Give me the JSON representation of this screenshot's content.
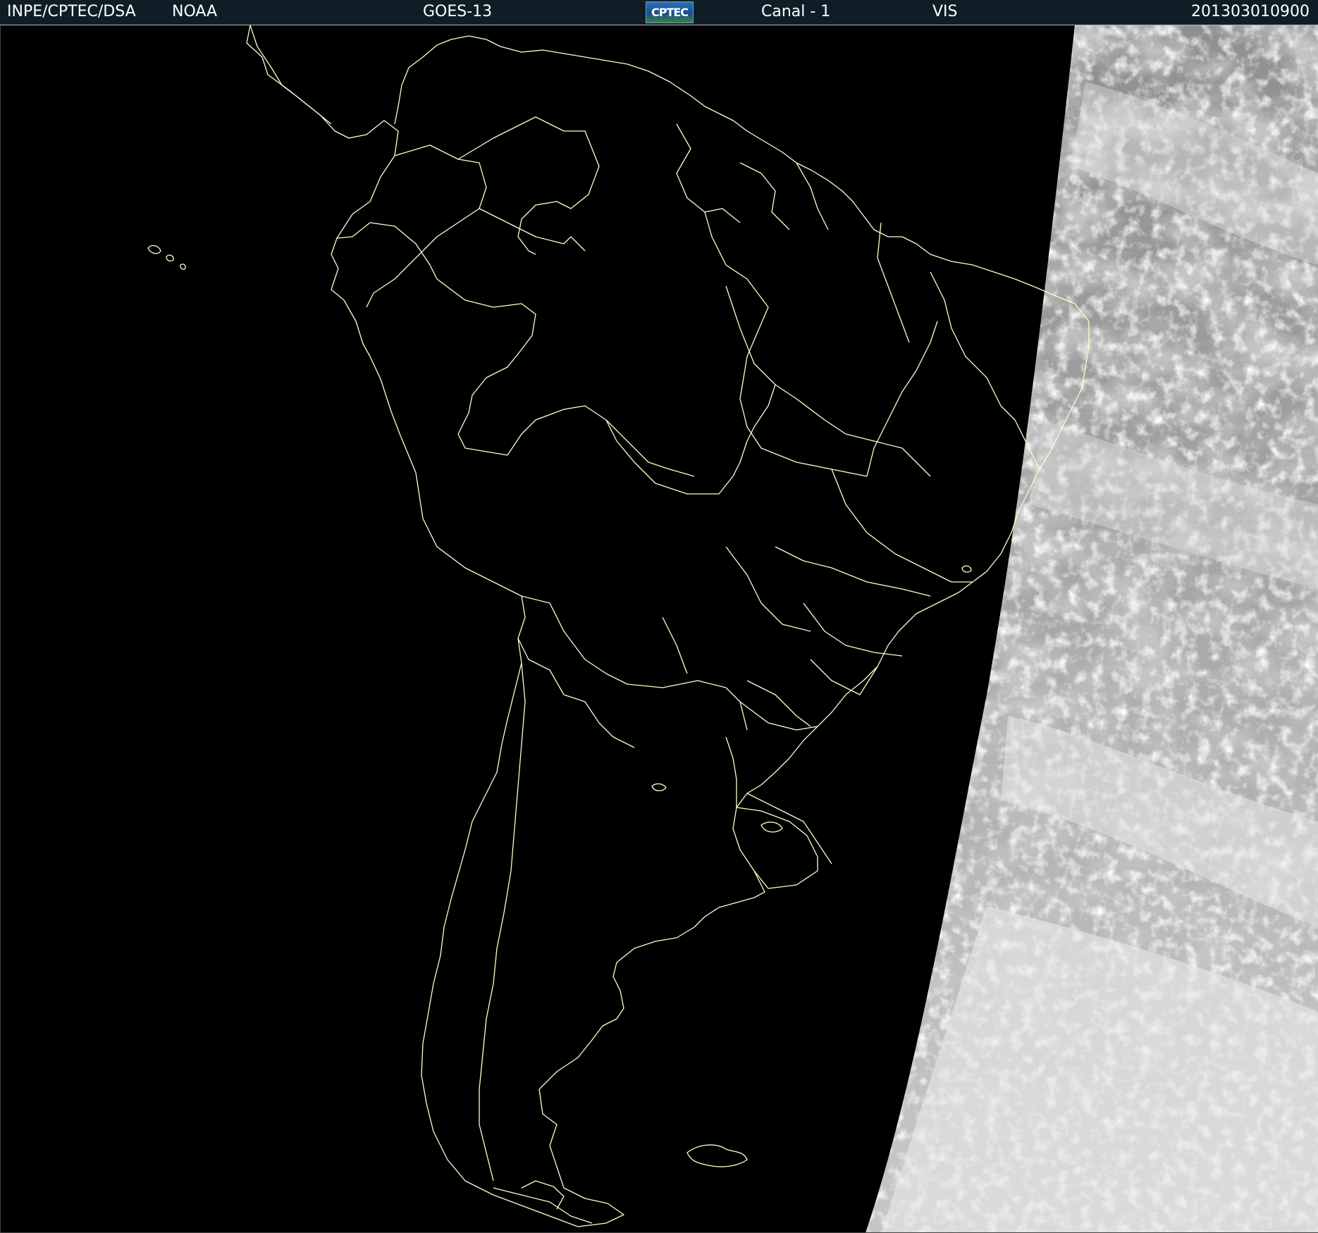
{
  "header": {
    "institution": "INPE/CPTEC/DSA",
    "agency": "NOAA",
    "satellite": "GOES-13",
    "logo_text": "CPTEC",
    "channel": "Canal - 1",
    "band": "VIS",
    "timestamp": "201303010900"
  },
  "map": {
    "region": "South America",
    "background_color": "#000000",
    "border_color": "#ffffcc",
    "cloud_color": "#d8d8d8"
  }
}
